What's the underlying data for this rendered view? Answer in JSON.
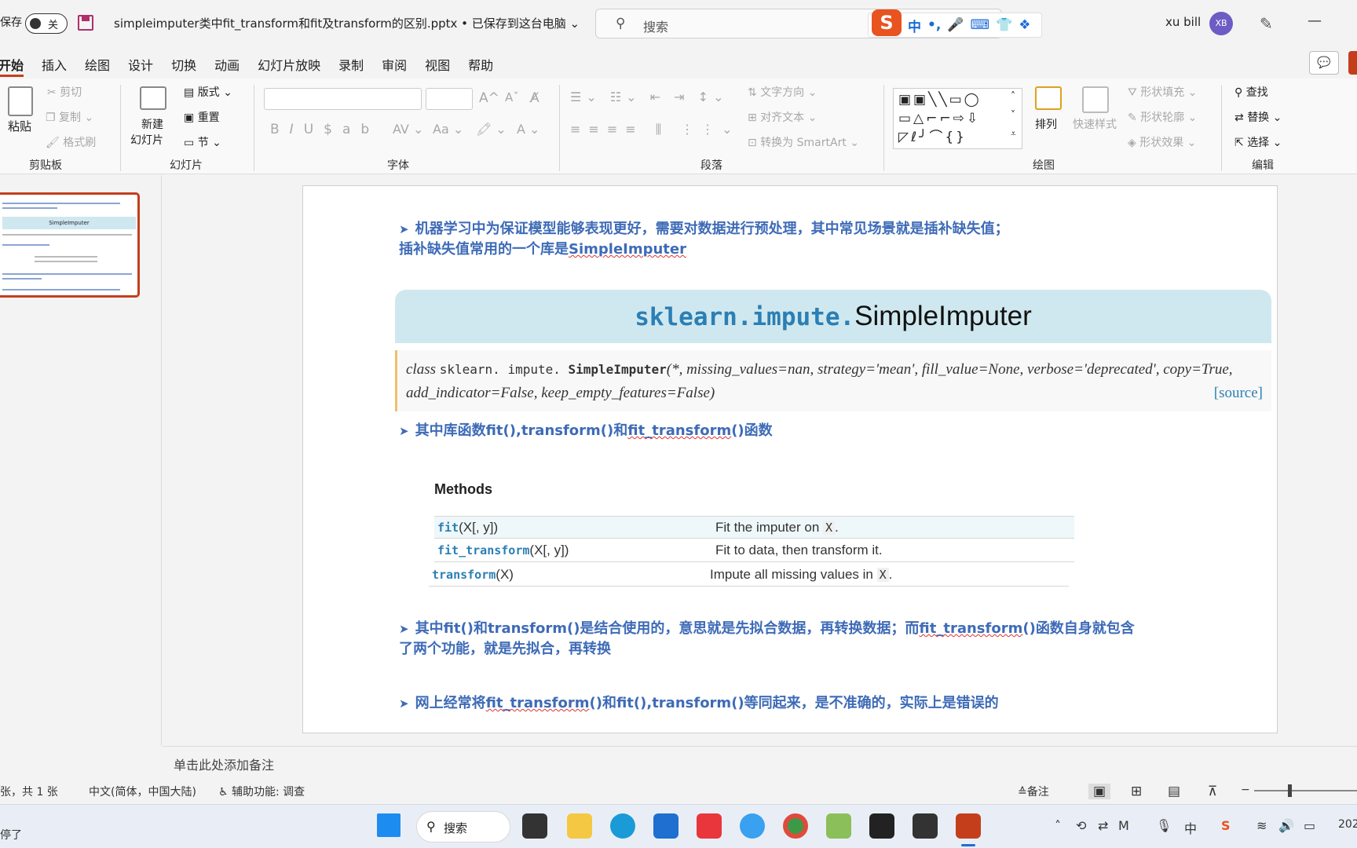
{
  "titlebar": {
    "autosave_label": "保存",
    "autosave_state": "关",
    "doc_title": "simpleimputer类中fit_transform和fit及transform的区别.pptx • 已保存到这台电脑 ⌄",
    "search_placeholder": "搜索",
    "user_name": "xu bill",
    "avatar_initials": "XB"
  },
  "ribbon_tabs": [
    "开始",
    "插入",
    "绘图",
    "设计",
    "切换",
    "动画",
    "幻灯片放映",
    "录制",
    "审阅",
    "视图",
    "帮助"
  ],
  "ribbon": {
    "clipboard": {
      "paste": "粘贴",
      "cut": "剪切",
      "copy": "复制",
      "format_painter": "格式刷",
      "label": "剪贴板"
    },
    "slides": {
      "new_slide_1": "新建",
      "new_slide_2": "幻灯片",
      "layout": "版式",
      "reset": "重置",
      "section": "节",
      "label": "幻灯片"
    },
    "font": {
      "label": "字体"
    },
    "paragraph": {
      "text_direction": "文字方向",
      "align_text": "对齐文本",
      "smartart": "转换为 SmartArt",
      "label": "段落"
    },
    "drawing": {
      "arrange": "排列",
      "quick_styles": "快速样式",
      "shape_fill": "形状填充",
      "shape_outline": "形状轮廓",
      "shape_effects": "形状效果",
      "label": "绘图"
    },
    "editing": {
      "find": "查找",
      "replace": "替换",
      "select": "选择",
      "label": "编辑"
    }
  },
  "slide": {
    "bullet1_line1": "机器学习中为保证模型能够表现更好，需要对数据进行预处理，其中常见场景就是插补缺失值；",
    "bullet1_line2_prefix": "插补缺失值常用的一个库是",
    "bullet1_line2_link": "SimpleImputer",
    "banner_module": "sklearn.impute.",
    "banner_class": "SimpleImputer",
    "sig_class_kw": "class",
    "sig_module": "sklearn. impute. ",
    "sig_name": "SimpleImputer",
    "sig_args_line1": "(*, missing_values=nan, strategy='mean', fill_value=None, verbose='deprecated', copy=True,",
    "sig_args_line2": "add_indicator=False, keep_empty_features=False)",
    "sig_source": "[source]",
    "bullet2_prefix": "其中库函数fit(),transform()和",
    "bullet2_link": "fit_transform",
    "bullet2_suffix": "()函数",
    "methods_heading": "Methods",
    "methods": [
      {
        "fn": "fit",
        "args": "(X[, y])",
        "desc": "Fit the imputer on ",
        "x": "X",
        "end": "."
      },
      {
        "fn": "fit_transform",
        "args": "(X[, y])",
        "desc": "Fit to data, then transform it.",
        "x": "",
        "end": ""
      },
      {
        "fn": "transform",
        "args": "(X)",
        "desc": "Impute all missing values in ",
        "x": "X",
        "end": "."
      }
    ],
    "bullet3_line1_prefix": "其中fit()和transform()是结合使用的，意思就是先拟合数据，再转换数据；而",
    "bullet3_link": "fit_transform",
    "bullet3_line1_suffix": "()函数自身就包含",
    "bullet3_line2": "了两个功能，就是先拟合，再转换",
    "bullet4_prefix": "网上经常将",
    "bullet4_link": "fit_transform",
    "bullet4_suffix": "()和fit(),transform()等同起来，是不准确的，实际上是错误的"
  },
  "notes_placeholder": "单击此处添加备注",
  "statusbar": {
    "slide_count": "张，共 1 张",
    "language": "中文(简体，中国大陆)",
    "accessibility": "辅助功能: 调查",
    "notes_button": "备注"
  },
  "taskbar": {
    "left_text": "停了",
    "search": "搜索",
    "year": "202"
  },
  "colors": {
    "accent": "#c43e1c",
    "bullet_text": "#3e6bb7",
    "banner": "#cfe8ef"
  }
}
